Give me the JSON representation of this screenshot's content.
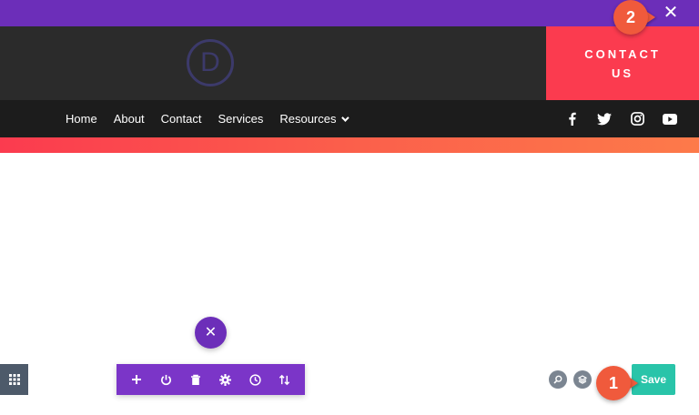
{
  "window": {
    "close_icon": "close-icon",
    "close_glyph": "✕"
  },
  "header": {
    "logo_letter": "D",
    "contact_button": {
      "line1": "CONTACT",
      "line2": "US"
    }
  },
  "nav": {
    "items": [
      {
        "label": "Home"
      },
      {
        "label": "About"
      },
      {
        "label": "Contact"
      },
      {
        "label": "Services"
      },
      {
        "label": "Resources"
      }
    ],
    "social": [
      "facebook-icon",
      "twitter-icon",
      "instagram-icon",
      "youtube-icon"
    ]
  },
  "builder": {
    "fab_close_glyph": "✕",
    "toolbar": [
      "add-icon",
      "power-icon",
      "trash-icon",
      "gear-icon",
      "history-icon",
      "sort-icon"
    ],
    "save_label": "Save"
  },
  "callouts": {
    "one": "1",
    "two": "2"
  },
  "colors": {
    "purple": "#6c2eb9",
    "toolbar_purple": "#7b35c8",
    "red": "#fb3b4f",
    "orange_callout": "#f05a3c",
    "save_green": "#29c4a9",
    "header_dark": "#2b2b2b",
    "nav_dark": "#1c1c1c"
  }
}
